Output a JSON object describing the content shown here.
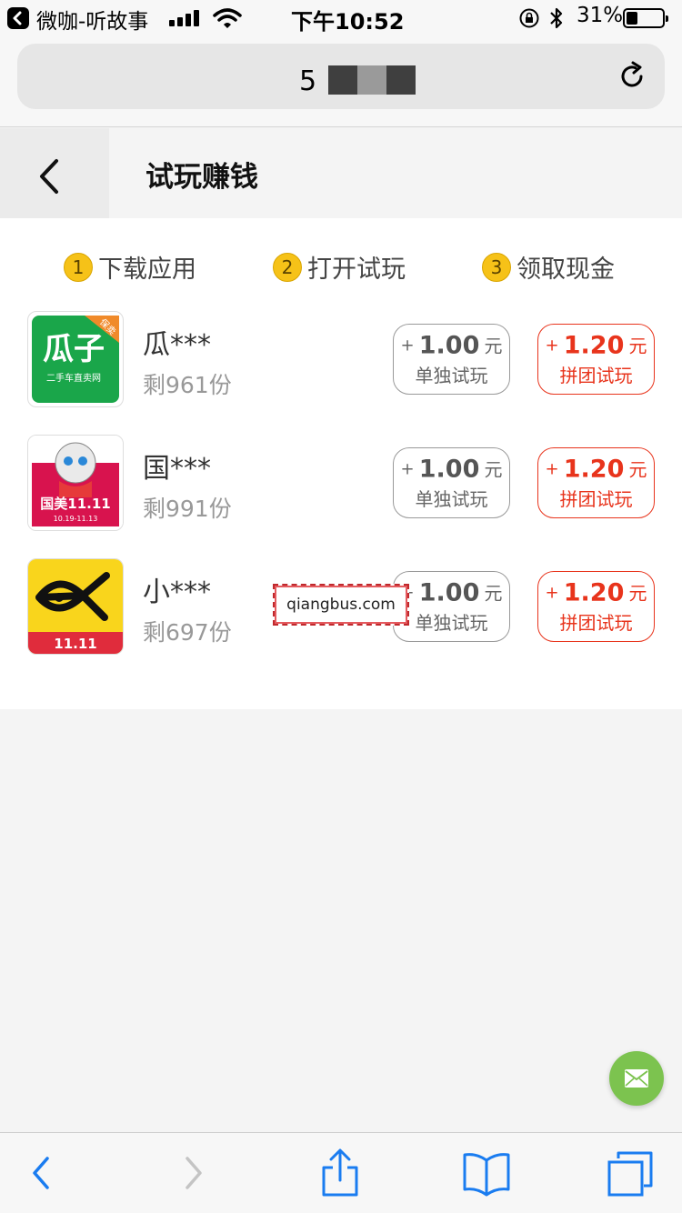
{
  "status_bar": {
    "back_app": "微咖-听故事",
    "time": "下午10:52",
    "battery": "31%",
    "battery_level": 0.31
  },
  "browser": {
    "url_text": "5",
    "reload_icon": "reload-icon"
  },
  "header": {
    "title": "试玩赚钱"
  },
  "steps": [
    {
      "num": "1",
      "label": "下载应用"
    },
    {
      "num": "2",
      "label": "打开试玩"
    },
    {
      "num": "3",
      "label": "领取现金"
    }
  ],
  "apps": [
    {
      "name": "瓜***",
      "remaining": "剩961份",
      "icon_title": "瓜子",
      "icon_sub": "二手车直卖网",
      "icon_badge": "保卖",
      "solo_amount": "1.00",
      "group_amount": "1.20"
    },
    {
      "name": "国***",
      "remaining": "剩991份",
      "icon_title": "国美11.11",
      "icon_sub": "10.19-11.13",
      "solo_amount": "1.00",
      "group_amount": "1.20"
    },
    {
      "name": "小***",
      "remaining": "剩697份",
      "icon_sub": "11.11",
      "solo_amount": "1.00",
      "group_amount": "1.20"
    }
  ],
  "labels": {
    "plus": "+",
    "unit": "元",
    "solo": "单独试玩",
    "group": "拼团试玩"
  },
  "watermark": "qiangbus.com",
  "colors": {
    "accent_red": "#e8341c",
    "step_yellow": "#f6c218",
    "fab_green": "#7cc34f",
    "ios_blue": "#1a7cf0"
  }
}
